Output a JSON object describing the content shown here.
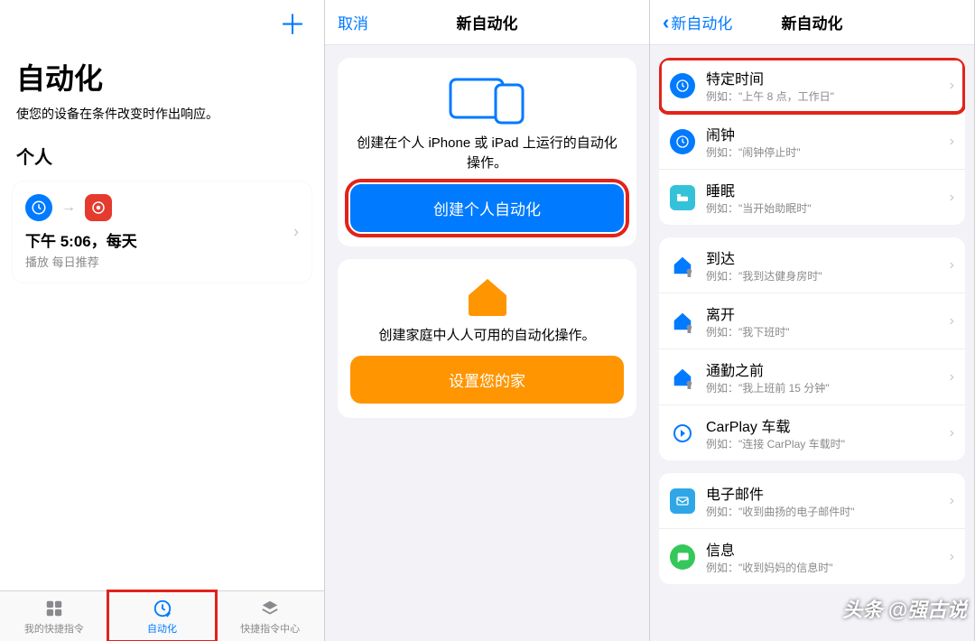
{
  "pane1": {
    "title": "自动化",
    "subtitle": "使您的设备在条件改变时作出响应。",
    "section": "个人",
    "automation": {
      "time_label": "下午 5:06，每天",
      "action_label": "播放 每日推荐"
    },
    "tabs": [
      {
        "id": "my-shortcuts",
        "label": "我的快捷指令",
        "active": false
      },
      {
        "id": "automation",
        "label": "自动化",
        "active": true
      },
      {
        "id": "gallery",
        "label": "快捷指令中心",
        "active": false
      }
    ]
  },
  "pane2": {
    "cancel": "取消",
    "title": "新自动化",
    "personal": {
      "desc": "创建在个人 iPhone 或 iPad 上运行的自动化操作。",
      "button": "创建个人自动化"
    },
    "home": {
      "desc": "创建家庭中人人可用的自动化操作。",
      "button": "设置您的家"
    }
  },
  "pane3": {
    "back": "新自动化",
    "title": "新自动化",
    "groups": [
      [
        {
          "id": "time-of-day",
          "icon": "clock-icon",
          "title": "特定时间",
          "sub": "例如：\"上午 8 点，工作日\"",
          "hl": true
        },
        {
          "id": "alarm",
          "icon": "clock-icon",
          "title": "闹钟",
          "sub": "例如：\"闹钟停止时\""
        },
        {
          "id": "sleep",
          "icon": "bed-icon",
          "title": "睡眠",
          "sub": "例如：\"当开始助眠时\""
        }
      ],
      [
        {
          "id": "arrive",
          "icon": "home-icon",
          "title": "到达",
          "sub": "例如：\"我到达健身房时\""
        },
        {
          "id": "leave",
          "icon": "home-icon",
          "title": "离开",
          "sub": "例如：\"我下班时\""
        },
        {
          "id": "commute",
          "icon": "home-icon",
          "title": "通勤之前",
          "sub": "例如：\"我上班前 15 分钟\""
        },
        {
          "id": "carplay",
          "icon": "carplay-icon",
          "title": "CarPlay 车载",
          "sub": "例如：\"连接 CarPlay 车载时\""
        }
      ],
      [
        {
          "id": "email",
          "icon": "mail-icon",
          "title": "电子邮件",
          "sub": "例如：\"收到曲扬的电子邮件时\""
        },
        {
          "id": "message",
          "icon": "message-icon",
          "title": "信息",
          "sub": "例如：\"收到妈妈的信息时\""
        }
      ]
    ]
  },
  "watermark": "头条 @强古说"
}
